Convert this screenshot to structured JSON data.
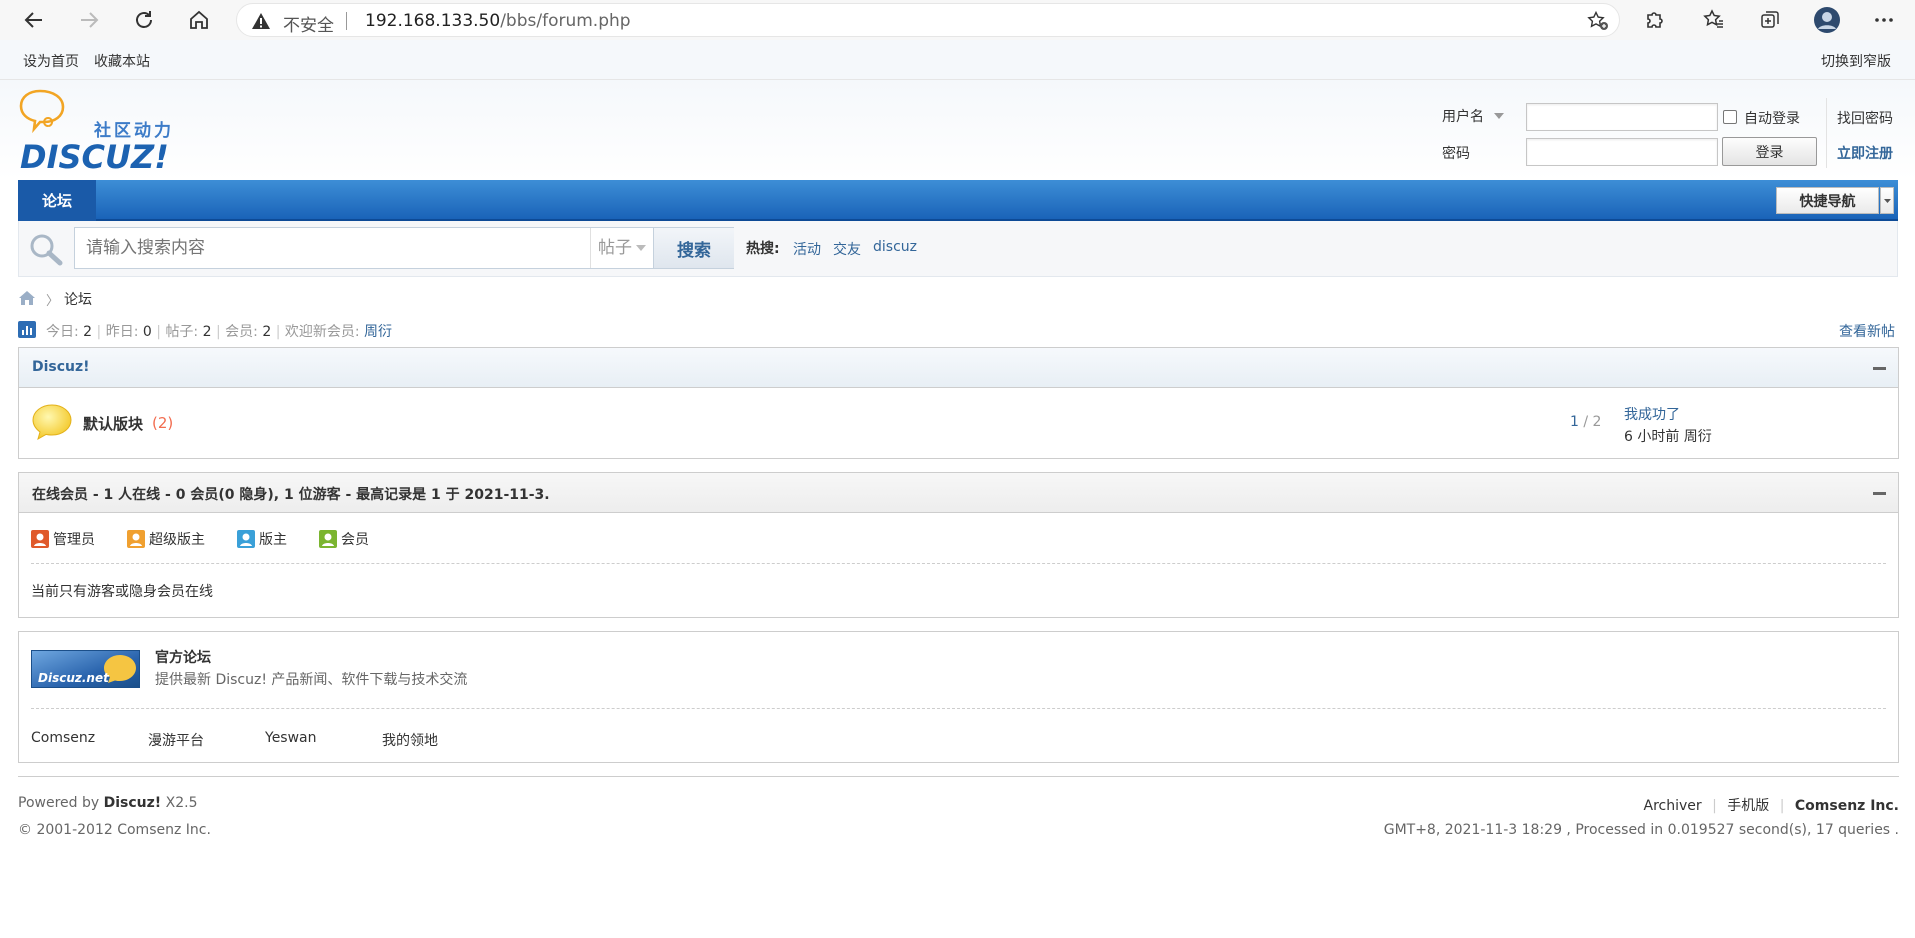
{
  "browser": {
    "insecure_label": "不安全",
    "url_host": "192.168.133.50",
    "url_path": "/bbs/forum.php"
  },
  "topbar": {
    "set_home": "设为首页",
    "bookmark": "收藏本站",
    "switch_width": "切换到窄版"
  },
  "logo": {
    "slogan": "社区动力",
    "brand": "DISCUZ!"
  },
  "login": {
    "username_label": "用户名",
    "password_label": "密码",
    "auto_login": "自动登录",
    "find_password": "找回密码",
    "login_button": "登录",
    "register": "立即注册"
  },
  "nav": {
    "forum": "论坛",
    "quick_nav": "快捷导航"
  },
  "search": {
    "placeholder": "请输入搜索内容",
    "type": "帖子",
    "button": "搜索",
    "hot_label": "热搜:",
    "hot_links": [
      "活动",
      "交友",
      "discuz"
    ]
  },
  "breadcrumb": {
    "current": "论坛"
  },
  "stats": {
    "today_label": "今日:",
    "today": "2",
    "yesterday_label": "昨日:",
    "yesterday": "0",
    "posts_label": "帖子:",
    "posts": "2",
    "members_label": "会员:",
    "members": "2",
    "welcome_label": "欢迎新会员:",
    "newest_member": "周衍",
    "view_new": "查看新帖"
  },
  "category": {
    "title": "Discuz!",
    "forum_name": "默认版块",
    "forum_count": "(2)",
    "threads": "1",
    "posts": "2",
    "last_post_title": "我成功了",
    "last_post_meta": "6 小时前 周衍"
  },
  "online": {
    "title": "在线会员 - 1 人在线 - 0 会员(0 隐身), 1 位游客 - 最高记录是 1 于 2021-11-3.",
    "legend": [
      "管理员",
      "超级版主",
      "版主",
      "会员"
    ],
    "legend_colors": [
      "#e05a2b",
      "#f0a030",
      "#3aa0d8",
      "#7bb530"
    ],
    "message": "当前只有游客或隐身会员在线"
  },
  "links": {
    "official_name": "官方论坛",
    "official_desc": "提供最新 Discuz! 产品新闻、软件下载与技术交流",
    "official_logo_text": "Discuz.net",
    "text_links": [
      "Comsenz",
      "漫游平台",
      "Yeswan",
      "我的领地"
    ]
  },
  "footer": {
    "powered_by": "Powered by",
    "product": "Discuz!",
    "version": "X2.5",
    "copyright": "© 2001-2012 Comsenz Inc.",
    "archiver": "Archiver",
    "mobile": "手机版",
    "company": "Comsenz Inc.",
    "debug": "GMT+8, 2021-11-3 18:29 , Processed in 0.019527 second(s), 17 queries ."
  }
}
